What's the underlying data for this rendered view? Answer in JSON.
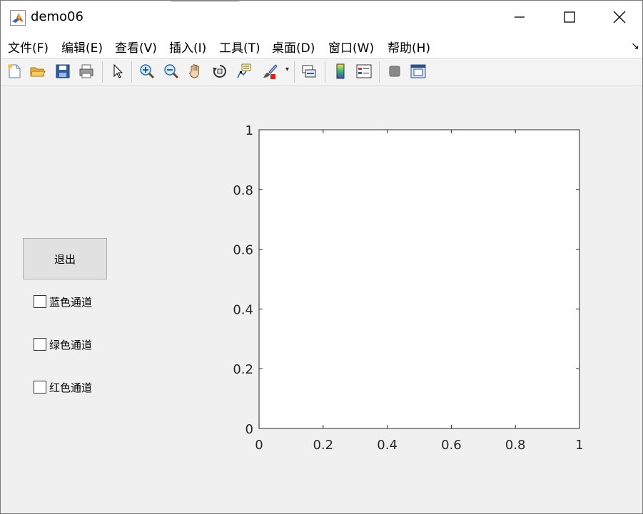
{
  "window": {
    "title": "demo06",
    "controls": {
      "minimize": "—",
      "maximize": "☐",
      "close": "✕"
    }
  },
  "menu": [
    "文件(F)",
    "编辑(E)",
    "查看(V)",
    "插入(I)",
    "工具(T)",
    "桌面(D)",
    "窗口(W)",
    "帮助(H)"
  ],
  "toolbar": {
    "icons": [
      "new-file-icon",
      "open-folder-icon",
      "save-icon",
      "print-icon",
      "pointer-arrow-icon",
      "zoom-in-icon",
      "zoom-out-icon",
      "pan-hand-icon",
      "rotate-3d-icon",
      "data-cursor-icon",
      "brush-icon",
      "link-plot-icon",
      "colorbar-icon",
      "legend-icon",
      "hide-plot-tools-icon",
      "show-plot-tools-icon"
    ]
  },
  "controls": {
    "quit_button": "退出",
    "checkboxes": [
      {
        "label": "蓝色通道",
        "checked": false
      },
      {
        "label": "绿色通道",
        "checked": false
      },
      {
        "label": "红色通道",
        "checked": false
      }
    ]
  },
  "chart_data": {
    "type": "line",
    "series": [],
    "xlim": [
      0,
      1
    ],
    "ylim": [
      0,
      1
    ],
    "xticks": [
      "0",
      "0.2",
      "0.4",
      "0.6",
      "0.8",
      "1"
    ],
    "yticks": [
      "0",
      "0.2",
      "0.4",
      "0.6",
      "0.8",
      "1"
    ],
    "grid": false
  }
}
